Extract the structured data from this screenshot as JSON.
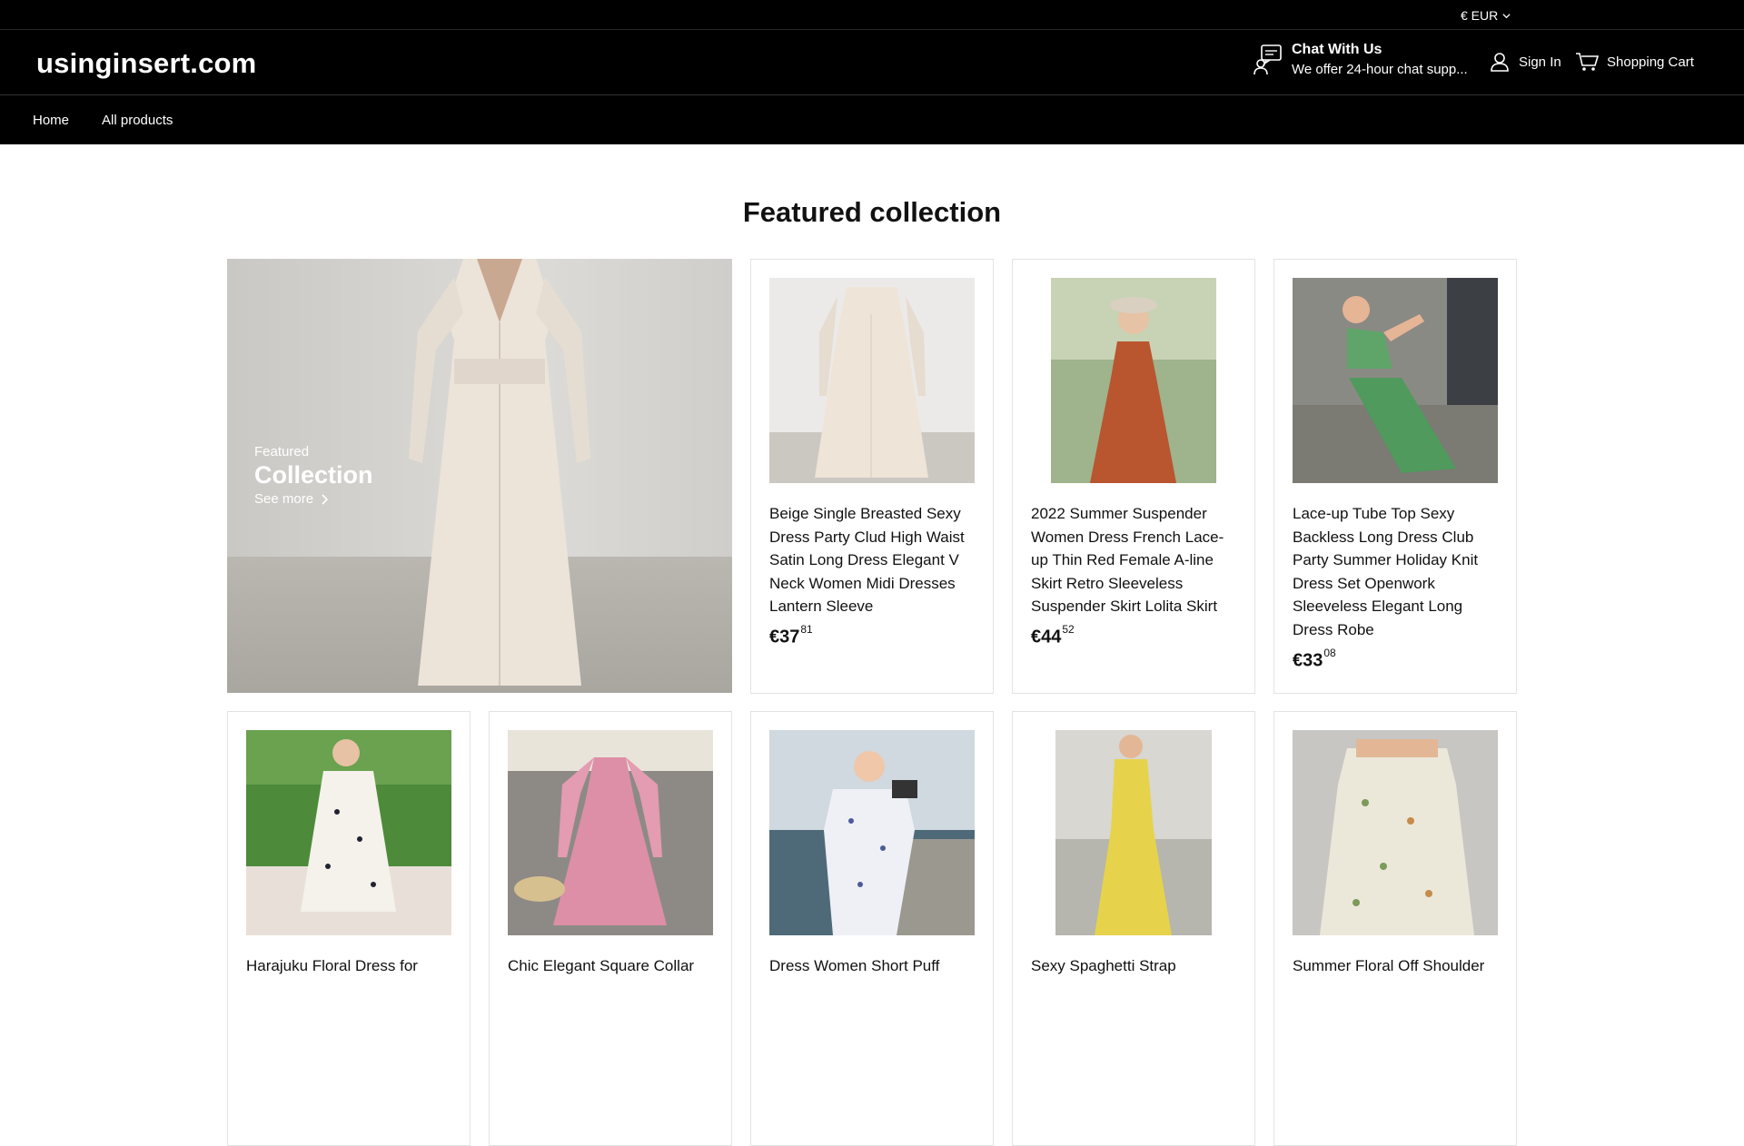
{
  "topbar": {
    "currency": "€ EUR"
  },
  "header": {
    "logo": "usinginsert.com",
    "chat_title": "Chat With Us",
    "chat_subtitle": "We offer 24-hour chat supp...",
    "signin": "Sign In",
    "cart": "Shopping Cart"
  },
  "nav": {
    "items": [
      "Home",
      "All products"
    ]
  },
  "main": {
    "title": "Featured collection",
    "feature": {
      "small": "Featured",
      "big": "Collection",
      "more": "See more"
    },
    "products": [
      {
        "name": "Beige Single Breasted Sexy Dress Party Clud High Waist Satin Long Dress Elegant V Neck Women Midi Dresses Lantern Sleeve",
        "price_main": "€37",
        "price_cents": "81"
      },
      {
        "name": "2022 Summer Suspender Women Dress French Lace-up Thin Red Female A-line Skirt Retro Sleeveless Suspender Skirt Lolita Skirt",
        "price_main": "€44",
        "price_cents": "52"
      },
      {
        "name": "Lace-up Tube Top Sexy Backless Long Dress Club Party Summer Holiday Knit Dress Set Openwork Sleeveless Elegant Long Dress Robe",
        "price_main": "€33",
        "price_cents": "08"
      },
      {
        "name": "Harajuku Floral Dress for"
      },
      {
        "name": "Chic Elegant Square Collar"
      },
      {
        "name": "Dress Women Short Puff"
      },
      {
        "name": "Sexy Spaghetti Strap"
      },
      {
        "name": "Summer Floral Off Shoulder"
      }
    ]
  }
}
